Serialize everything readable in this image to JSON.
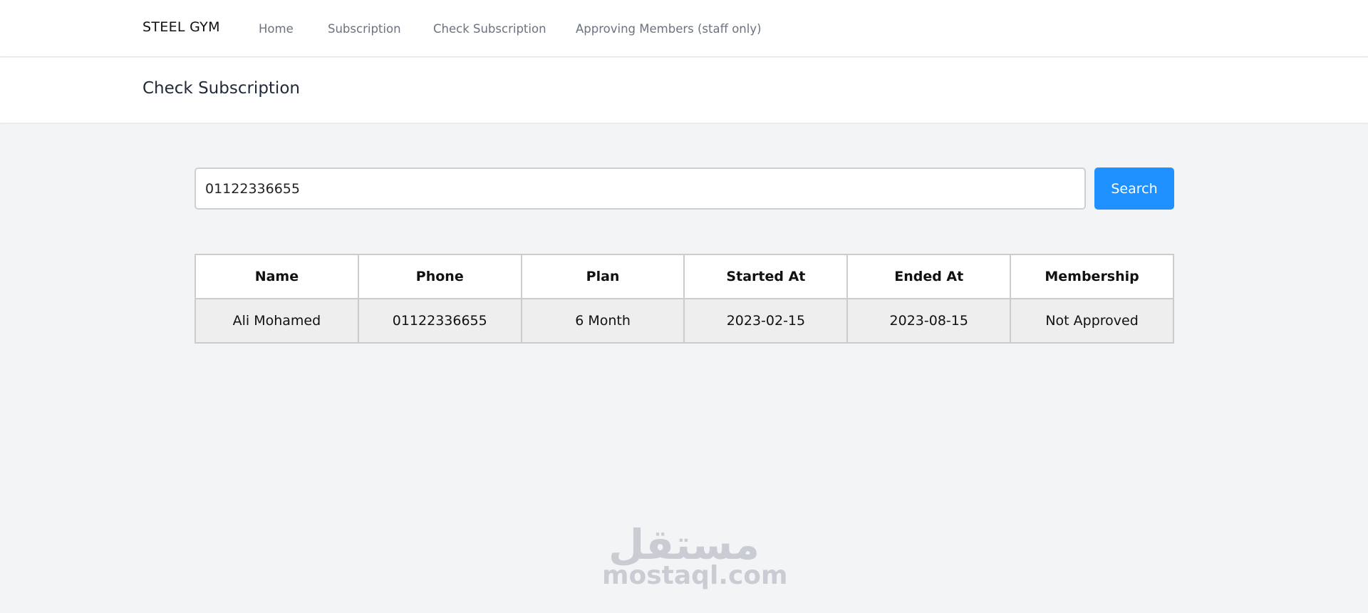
{
  "navbar": {
    "brand": "STEEL GYM",
    "links": [
      {
        "label": "Home"
      },
      {
        "label": "Subscription"
      },
      {
        "label": "Check Subscription"
      },
      {
        "label": "Approving Members (staff only)"
      }
    ]
  },
  "header": {
    "title": "Check Subscription"
  },
  "search": {
    "value": "01122336655",
    "button_label": "Search"
  },
  "table": {
    "headers": [
      "Name",
      "Phone",
      "Plan",
      "Started At",
      "Ended At",
      "Membership"
    ],
    "rows": [
      [
        "Ali Mohamed",
        "01122336655",
        "6 Month",
        "2023-02-15",
        "2023-08-15",
        "Not Approved"
      ]
    ]
  },
  "watermark": {
    "arabic": "مستقل",
    "latin": "mostaql.com"
  },
  "colors": {
    "accent": "#1e90ff",
    "background": "#f3f4f6"
  }
}
